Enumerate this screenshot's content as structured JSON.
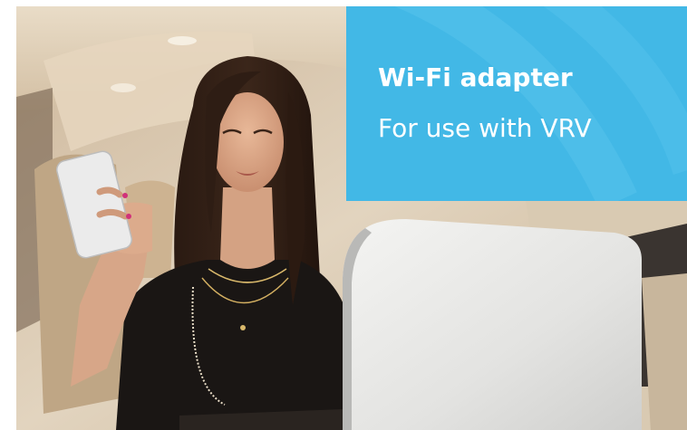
{
  "banner": {
    "title": "Wi-Fi adapter",
    "subtitle": "For use with VRV"
  },
  "colors": {
    "panel": "#42b8e6",
    "panel_text": "#ffffff",
    "cabin_beige": "#d8c7ae"
  }
}
